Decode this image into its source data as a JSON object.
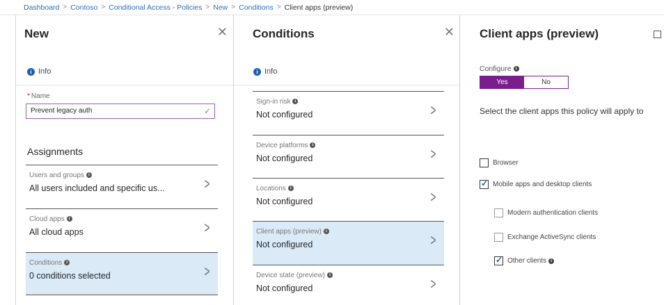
{
  "breadcrumb": [
    "Dashboard",
    "Contoso",
    "Conditional Access - Policies",
    "New",
    "Conditions",
    "Client apps (preview)"
  ],
  "new_blade": {
    "title": "New",
    "info": "Info",
    "name_label": "Name",
    "name_required": "*",
    "name_value": "Prevent legacy auth",
    "section_title": "Assignments",
    "items": [
      {
        "label": "Users and groups",
        "value": "All users included and specific us..."
      },
      {
        "label": "Cloud apps",
        "value": "All cloud apps"
      },
      {
        "label": "Conditions",
        "value": "0 conditions selected",
        "selected": true
      }
    ]
  },
  "conditions_blade": {
    "title": "Conditions",
    "info": "Info",
    "items": [
      {
        "label": "Sign-in risk",
        "value": "Not configured"
      },
      {
        "label": "Device platforms",
        "value": "Not configured"
      },
      {
        "label": "Locations",
        "value": "Not configured"
      },
      {
        "label": "Client apps (preview)",
        "value": "Not configured",
        "selected": true
      },
      {
        "label": "Device state (preview)",
        "value": "Not configured"
      }
    ]
  },
  "client_apps_blade": {
    "title": "Client apps (preview)",
    "configure_label": "Configure",
    "toggle_yes": "Yes",
    "toggle_no": "No",
    "configure_value": "Yes",
    "description": "Select the client apps this policy will apply to",
    "options": {
      "browser": {
        "label": "Browser",
        "checked": false
      },
      "mobile": {
        "label": "Mobile apps and desktop clients",
        "checked": true
      },
      "modern": {
        "label": "Modern authentication clients",
        "checked": false
      },
      "eas": {
        "label": "Exchange ActiveSync clients",
        "checked": false
      },
      "other": {
        "label": "Other clients",
        "checked": true
      }
    }
  },
  "icons": {
    "info": "info-icon",
    "close": "close-icon",
    "maximize": "maximize-icon",
    "chevron": "chevron-right-icon",
    "check": "checkmark-icon"
  },
  "colors": {
    "accent_purple": "#7a1e8c",
    "link_blue": "#2f6fb4",
    "selected_bg": "#dbeaf7",
    "info_blue": "#1b5fae",
    "valid_green": "#4caf50"
  }
}
